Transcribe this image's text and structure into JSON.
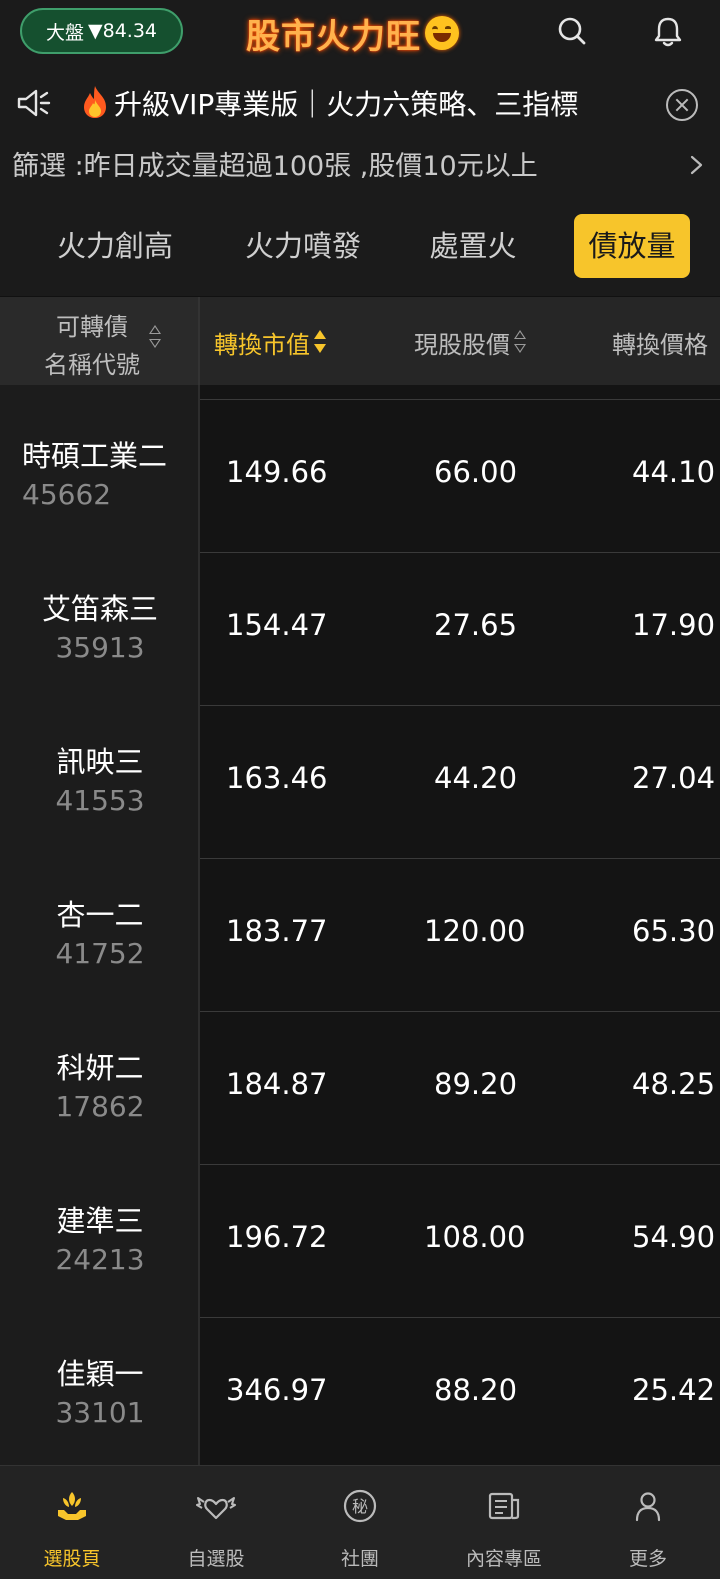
{
  "header": {
    "market_label": "大盤",
    "market_value": "▼84.34",
    "logo_text": "股市火力旺"
  },
  "announcement": {
    "text": "升級VIP專業版｜火力六策略、三指標"
  },
  "filter": {
    "text": "篩選 :昨日成交量超過100張 ,股價10元以上"
  },
  "tabs": [
    {
      "label": "火力創高"
    },
    {
      "label": "火力噴發"
    },
    {
      "label": "處置火"
    },
    {
      "label": "債放量"
    }
  ],
  "table": {
    "headers": {
      "name_line1": "可轉債",
      "name_line2": "名稱代號",
      "col1": "轉換市值",
      "col2": "現股股價",
      "col3": "轉換價格"
    },
    "rows": [
      {
        "name": "時碩工業二",
        "code": "45662",
        "v1": "149.66",
        "v2": "66.00",
        "v3": "44.10"
      },
      {
        "name": "艾笛森三",
        "code": "35913",
        "v1": "154.47",
        "v2": "27.65",
        "v3": "17.90"
      },
      {
        "name": "訊映三",
        "code": "41553",
        "v1": "163.46",
        "v2": "44.20",
        "v3": "27.04"
      },
      {
        "name": "杏一二",
        "code": "41752",
        "v1": "183.77",
        "v2": "120.00",
        "v3": "65.30"
      },
      {
        "name": "科妍二",
        "code": "17862",
        "v1": "184.87",
        "v2": "89.20",
        "v3": "48.25"
      },
      {
        "name": "建準三",
        "code": "24213",
        "v1": "196.72",
        "v2": "108.00",
        "v3": "54.90"
      },
      {
        "name": "佳穎一",
        "code": "33101",
        "v1": "346.97",
        "v2": "88.20",
        "v3": "25.42"
      }
    ]
  },
  "bottom_nav": [
    {
      "label": "選股頁",
      "icon": "lotus-hand-icon"
    },
    {
      "label": "自選股",
      "icon": "winged-heart-icon"
    },
    {
      "label": "社團",
      "icon": "secret-circle-icon"
    },
    {
      "label": "內容專區",
      "icon": "newspaper-icon"
    },
    {
      "label": "更多",
      "icon": "person-icon"
    }
  ],
  "icon_text": {
    "secret": "秘"
  },
  "colors": {
    "accent": "#f7c52b",
    "market_pill_bg": "#15502f",
    "market_pill_border": "#3f9e6b",
    "background": "#111111"
  }
}
